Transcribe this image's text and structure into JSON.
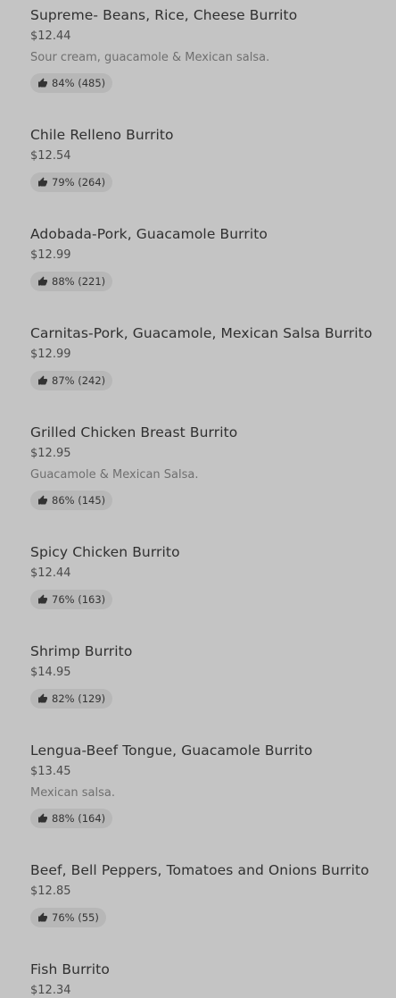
{
  "menu": {
    "items": [
      {
        "name": "Supreme- Beans, Rice, Cheese Burrito",
        "price": "$12.44",
        "description": "Sour cream, guacamole & Mexican salsa.",
        "rating": "84% (485)"
      },
      {
        "name": "Chile Relleno Burrito",
        "price": "$12.54",
        "description": "",
        "rating": "79% (264)"
      },
      {
        "name": "Adobada-Pork, Guacamole Burrito",
        "price": "$12.99",
        "description": "",
        "rating": "88% (221)"
      },
      {
        "name": "Carnitas-Pork, Guacamole, Mexican Salsa Burrito",
        "price": "$12.99",
        "description": "",
        "rating": "87% (242)"
      },
      {
        "name": "Grilled Chicken Breast Burrito",
        "price": "$12.95",
        "description": "Guacamole & Mexican Salsa.",
        "rating": "86% (145)"
      },
      {
        "name": "Spicy Chicken Burrito",
        "price": "$12.44",
        "description": "",
        "rating": "76% (163)"
      },
      {
        "name": "Shrimp Burrito",
        "price": "$14.95",
        "description": "",
        "rating": "82% (129)"
      },
      {
        "name": "Lengua-Beef Tongue, Guacamole Burrito",
        "price": "$13.45",
        "description": "Mexican salsa.",
        "rating": "88% (164)"
      },
      {
        "name": "Beef, Bell Peppers, Tomatoes and Onions Burrito",
        "price": "$12.85",
        "description": "",
        "rating": "76% (55)"
      },
      {
        "name": "Fish Burrito",
        "price": "$12.34",
        "description": "",
        "rating": ""
      }
    ],
    "rating_icon": "thumbs-up-icon"
  }
}
